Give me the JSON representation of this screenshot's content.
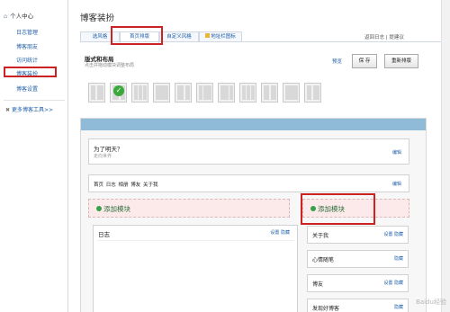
{
  "sidebar": {
    "header": "个人中心",
    "items": [
      {
        "label": "日志管理"
      },
      {
        "label": "博客朋友"
      },
      {
        "label": "访问统计"
      },
      {
        "label": "博客装扮"
      },
      {
        "label": "博客设置"
      }
    ],
    "active_index": 3,
    "more_tools": "更多博客工具>>"
  },
  "header": {
    "title": "博客装扮",
    "back_link": "返回日志 | 提建议"
  },
  "tabs": [
    {
      "label": "选风格"
    },
    {
      "label": "首页排版"
    },
    {
      "label": "自定义风格"
    },
    {
      "label": "地址栏图标"
    }
  ],
  "active_tab": 1,
  "layout": {
    "title": "版式和布局",
    "description": "点击并拖动模块调整布局",
    "preview_label": "预览",
    "save_label": "保 存",
    "reset_label": "重新排版"
  },
  "templates": {
    "count": 11,
    "selected_index": 1
  },
  "editor": {
    "header_title": "为了明天？",
    "header_subtitle": "走向世界",
    "header_edit": "编辑",
    "nav_items": "首页 日志 相册 博友 关于我",
    "nav_edit": "编辑",
    "add_module_label": "添加模块",
    "blog_widget": {
      "title": "日志",
      "links": "设置  隐藏"
    },
    "side_widgets": [
      {
        "title": "关于我",
        "links": "设置  隐藏"
      },
      {
        "title": "心情随笔",
        "links": "隐藏"
      },
      {
        "title": "博友",
        "links": "设置  隐藏"
      },
      {
        "title": "发现好博客",
        "links": "隐藏"
      }
    ]
  },
  "watermark": "Baidu经验",
  "colors": {
    "accent_link": "#1f5fa8",
    "highlight_red": "#cc2222",
    "editor_bar": "#8fbbd9",
    "add_zone_bg": "#fceaea",
    "check_green": "#3aa83a"
  }
}
